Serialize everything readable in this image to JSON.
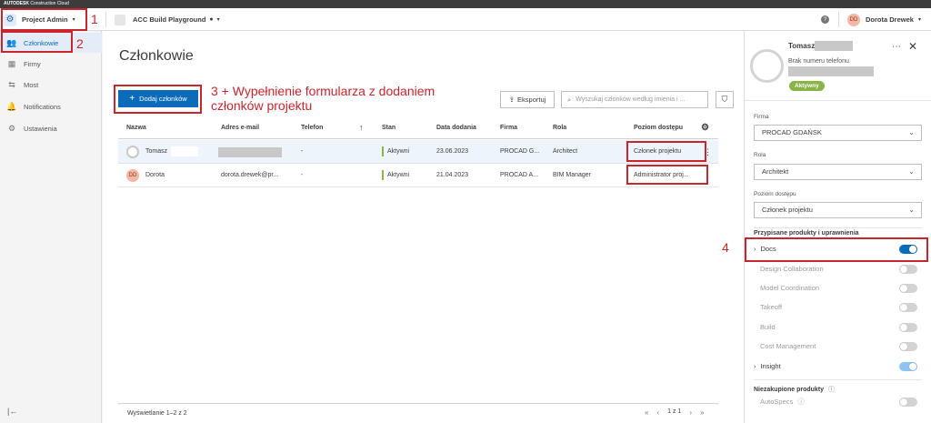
{
  "topstrip": {
    "brand": "AUTODESK",
    "product": "Construction Cloud"
  },
  "header": {
    "module": "Project Admin",
    "project": "ACC Build Playground",
    "help": "?",
    "user_initials": "DD",
    "user_name": "Dorota Drewek"
  },
  "sidebar": {
    "items": [
      {
        "label": "Członkowie",
        "icon": "members-icon"
      },
      {
        "label": "Firmy",
        "icon": "company-icon"
      },
      {
        "label": "Most",
        "icon": "bridge-icon"
      },
      {
        "label": "Notifications",
        "icon": "bell-icon"
      },
      {
        "label": "Ustawienia",
        "icon": "gear-icon"
      }
    ],
    "collapse": "|←"
  },
  "main": {
    "title": "Członkowie",
    "add_button": "Dodaj członków",
    "export_button": "Eksportuj",
    "search_placeholder": "Wyszukaj członków według imienia i ...",
    "columns": [
      "Nazwa",
      "Adres e-mail",
      "Telefon",
      "↑",
      "Stan",
      "Data dodania",
      "Firma",
      "Rola",
      "Poziom dostępu"
    ],
    "rows": [
      {
        "name": "Tomasz",
        "email": "",
        "phone": "-",
        "status": "Aktywni",
        "date": "23.06.2023",
        "company": "PROCAD G...",
        "role": "Architect",
        "access": "Członek projektu"
      },
      {
        "name": "Dorota",
        "initials": "DD",
        "email": "dorota.drewek@pr...",
        "phone": "-",
        "status": "Aktywni",
        "date": "21.04.2023",
        "company": "PROCAD A...",
        "role": "BIM Manager",
        "access": "Administrator proj..."
      }
    ],
    "footer_text": "Wyświetlanie 1–2 z 2",
    "pager": {
      "first": "«",
      "prev": "‹",
      "page": "1 z 1",
      "next": "›",
      "last": "»"
    }
  },
  "annotations": {
    "a1": "1",
    "a2": "2",
    "a3": "3 + Wypełnienie formularza z dodaniem członków projektu",
    "a4": "4"
  },
  "panel": {
    "name": "Tomasz",
    "phone": "Brak numeru telefonu",
    "status": "Aktywny",
    "company_label": "Firma",
    "company_value": "PROCAD GDAŃSK",
    "role_label": "Rola",
    "role_value": "Architekt",
    "access_label": "Poziom dostępu",
    "access_value": "Członek projektu",
    "products_heading": "Przypisane produkty i uprawnienia",
    "products": [
      {
        "label": "Docs",
        "state": "on",
        "expandable": true
      },
      {
        "label": "Design Collaboration",
        "state": "off"
      },
      {
        "label": "Model Coordination",
        "state": "off"
      },
      {
        "label": "Takeoff",
        "state": "off"
      },
      {
        "label": "Build",
        "state": "off"
      },
      {
        "label": "Cost Management",
        "state": "off"
      },
      {
        "label": "Insight",
        "state": "onlight",
        "expandable": true
      }
    ],
    "unpurchased_heading": "Niezakupione produkty",
    "unpurchased": [
      {
        "label": "AutoSpecs",
        "state": "off"
      }
    ]
  },
  "colors": {
    "accent": "#0a6bba",
    "annotation": "#c8252c",
    "active_status": "#8ab34a"
  }
}
